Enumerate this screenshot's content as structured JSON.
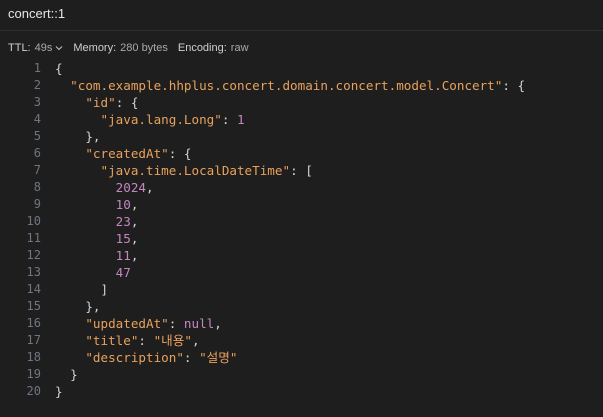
{
  "window": {
    "title": "concert::1"
  },
  "info": {
    "ttl_label": "TTL:",
    "ttl_value": "49s",
    "memory_label": "Memory:",
    "memory_value": "280 bytes",
    "encoding_label": "Encoding:",
    "encoding_value": "raw"
  },
  "editor": {
    "lines": [
      [
        [
          "p",
          "{"
        ]
      ],
      [
        [
          "p",
          "  "
        ],
        [
          "k",
          "\"com.example.hhplus.concert.domain.concert.model.Concert\""
        ],
        [
          "p",
          ": {"
        ]
      ],
      [
        [
          "p",
          "    "
        ],
        [
          "k",
          "\"id\""
        ],
        [
          "p",
          ": {"
        ]
      ],
      [
        [
          "p",
          "      "
        ],
        [
          "k",
          "\"java.lang.Long\""
        ],
        [
          "p",
          ": "
        ],
        [
          "n",
          "1"
        ]
      ],
      [
        [
          "p",
          "    },"
        ]
      ],
      [
        [
          "p",
          "    "
        ],
        [
          "k",
          "\"createdAt\""
        ],
        [
          "p",
          ": {"
        ]
      ],
      [
        [
          "p",
          "      "
        ],
        [
          "k",
          "\"java.time.LocalDateTime\""
        ],
        [
          "p",
          ": ["
        ]
      ],
      [
        [
          "p",
          "        "
        ],
        [
          "n",
          "2024"
        ],
        [
          "p",
          ","
        ]
      ],
      [
        [
          "p",
          "        "
        ],
        [
          "n",
          "10"
        ],
        [
          "p",
          ","
        ]
      ],
      [
        [
          "p",
          "        "
        ],
        [
          "n",
          "23"
        ],
        [
          "p",
          ","
        ]
      ],
      [
        [
          "p",
          "        "
        ],
        [
          "n",
          "15"
        ],
        [
          "p",
          ","
        ]
      ],
      [
        [
          "p",
          "        "
        ],
        [
          "n",
          "11"
        ],
        [
          "p",
          ","
        ]
      ],
      [
        [
          "p",
          "        "
        ],
        [
          "n",
          "47"
        ]
      ],
      [
        [
          "p",
          "      ]"
        ]
      ],
      [
        [
          "p",
          "    },"
        ]
      ],
      [
        [
          "p",
          "    "
        ],
        [
          "k",
          "\"updatedAt\""
        ],
        [
          "p",
          ": "
        ],
        [
          "nl",
          "null"
        ],
        [
          "p",
          ","
        ]
      ],
      [
        [
          "p",
          "    "
        ],
        [
          "k",
          "\"title\""
        ],
        [
          "p",
          ": "
        ],
        [
          "s",
          "\"내용\""
        ],
        [
          "p",
          ","
        ]
      ],
      [
        [
          "p",
          "    "
        ],
        [
          "k",
          "\"description\""
        ],
        [
          "p",
          ": "
        ],
        [
          "s",
          "\"설명\""
        ]
      ],
      [
        [
          "p",
          "  }"
        ]
      ],
      [
        [
          "p",
          "}"
        ]
      ]
    ]
  },
  "colors": {
    "background": "#1e1e1e",
    "key": "#e8a15c",
    "number": "#c586c0",
    "line_number": "#6e7681"
  },
  "icons": {
    "ttl_dropdown": "chevron-down-icon"
  }
}
